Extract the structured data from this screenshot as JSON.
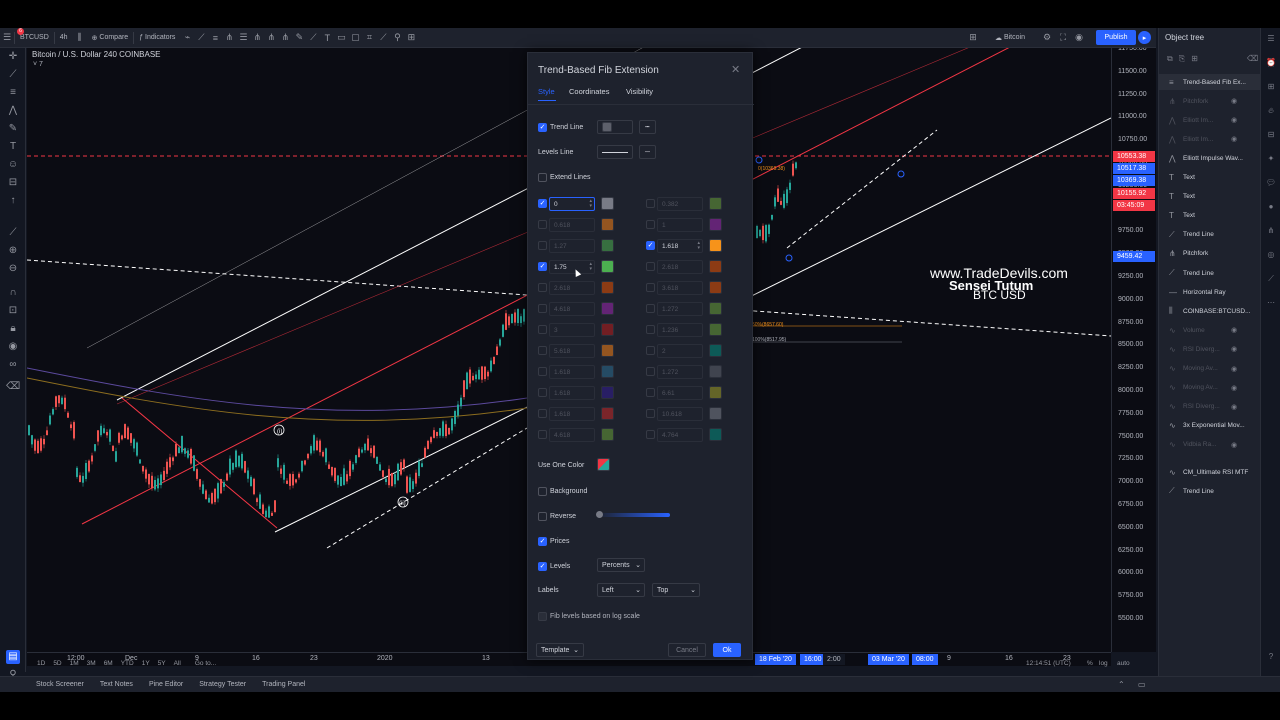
{
  "header": {
    "symbol": "BTCUSD",
    "interval": "4h",
    "compare_label": "Compare",
    "indicators_label": "Indicators",
    "layout_name": "Bitcoin",
    "publish_label": "Publish",
    "notification_count": "6"
  },
  "chart": {
    "title": "Bitcoin / U.S. Dollar  240  COINBASE",
    "collapse": "˅ 7",
    "watermark": {
      "line1": "www.TradeDevils.com",
      "line2": "Sensei Tutum",
      "line3": "BTC USD"
    },
    "price_ticks": [
      "11750.00",
      "11500.00",
      "11250.00",
      "11000.00",
      "10750.00",
      "10500.00",
      "10250.00",
      "10000.00",
      "9750.00",
      "9500.00",
      "9250.00",
      "9000.00",
      "8750.00",
      "8500.00",
      "8250.00",
      "8000.00",
      "7750.00",
      "7500.00",
      "7250.00",
      "7000.00",
      "6750.00",
      "6500.00",
      "6250.00",
      "6000.00",
      "5750.00",
      "5500.00"
    ],
    "price_labels": [
      {
        "text": "10553.38",
        "color": "#f23645"
      },
      {
        "text": "10517.38",
        "color": "#2962ff"
      },
      {
        "text": "10369.38",
        "color": "#2962ff"
      },
      {
        "text": "10155.92",
        "color": "#f23645"
      },
      {
        "text": "03:45:09",
        "color": "#f23645"
      },
      {
        "text": "9459.42",
        "color": "#2962ff"
      }
    ],
    "time_ticks": [
      "12:00",
      "Dec",
      "9",
      "16",
      "23",
      "2020",
      "13",
      "9",
      "16",
      "23"
    ],
    "time_tags": [
      "18 Feb '20",
      "16:00",
      "2:00",
      "03 Mar '20",
      "08:00"
    ],
    "fib_labels": [
      "50%(8657.60)",
      "100%(8517.95)"
    ],
    "wave_labels": [
      "(i)",
      "(ii)"
    ],
    "pitch_label": "0(10369.38)"
  },
  "range_bar": {
    "ranges": [
      "1D",
      "5D",
      "1M",
      "3M",
      "6M",
      "YTD",
      "1Y",
      "5Y",
      "All"
    ],
    "goto": "Go to...",
    "clock": "12:14:51 (UTC)",
    "pct": "%",
    "log": "log",
    "auto": "auto"
  },
  "bottom_tabs": [
    "Stock Screener",
    "Text Notes",
    "Pine Editor",
    "Strategy Tester",
    "Trading Panel"
  ],
  "object_tree": {
    "title": "Object tree",
    "items": [
      {
        "label": "Trend-Based Fib Ex...",
        "icon": "fib-icon",
        "dim": false,
        "selected": true
      },
      {
        "label": "Pitchfork",
        "icon": "pitchfork-icon",
        "dim": true
      },
      {
        "label": "Elliott Im...",
        "icon": "elliott-icon",
        "dim": true
      },
      {
        "label": "Elliott Im...",
        "icon": "elliott-icon",
        "dim": true
      },
      {
        "label": "Elliott Impulse Wav...",
        "icon": "elliott-icon",
        "dim": false
      },
      {
        "label": "Text",
        "icon": "text-icon",
        "dim": false
      },
      {
        "label": "Text",
        "icon": "text-icon",
        "dim": false
      },
      {
        "label": "Text",
        "icon": "text-icon",
        "dim": false
      },
      {
        "label": "Trend Line",
        "icon": "trendline-icon",
        "dim": false
      },
      {
        "label": "Pitchfork",
        "icon": "pitchfork-icon",
        "dim": false
      },
      {
        "label": "Trend Line",
        "icon": "trendline-icon",
        "dim": false
      },
      {
        "label": "Horizontal Ray",
        "icon": "ray-icon",
        "dim": false
      },
      {
        "label": "COINBASE:BTCUSD...",
        "icon": "symbol-icon",
        "dim": false
      },
      {
        "label": "Volume",
        "icon": "indicator-icon",
        "dim": true
      },
      {
        "label": "RSI Diverg...",
        "icon": "indicator-icon",
        "dim": true
      },
      {
        "label": "Moving Av...",
        "icon": "indicator-icon",
        "dim": true
      },
      {
        "label": "Moving Av...",
        "icon": "indicator-icon",
        "dim": true
      },
      {
        "label": "RSI Diverg...",
        "icon": "indicator-icon",
        "dim": true
      },
      {
        "label": "3x Exponential Mov...",
        "icon": "indicator-icon",
        "dim": false
      },
      {
        "label": "Vidbia Ra...",
        "icon": "indicator-icon",
        "dim": true
      },
      {
        "label": "CM_Ultimate RSI MTF",
        "icon": "indicator-icon",
        "dim": false
      },
      {
        "label": "Trend Line",
        "icon": "trendline-icon",
        "dim": false
      }
    ]
  },
  "dialog": {
    "title": "Trend-Based Fib Extension",
    "tabs": [
      "Style",
      "Coordinates",
      "Visibility"
    ],
    "trend_line_label": "Trend Line",
    "levels_line_label": "Levels Line",
    "extend_lines_label": "Extend Lines",
    "levels_left": [
      {
        "value": "0",
        "checked": true,
        "color": "#787b86"
      },
      {
        "value": "0.618",
        "checked": false,
        "color": "#f57f17"
      },
      {
        "value": "1.27",
        "checked": false,
        "color": "#4caf50"
      },
      {
        "value": "1.75",
        "checked": true,
        "color": "#4caf50"
      },
      {
        "value": "2.618",
        "checked": false,
        "color": "#e65100"
      },
      {
        "value": "4.618",
        "checked": false,
        "color": "#9c27b0"
      },
      {
        "value": "3",
        "checked": false,
        "color": "#b71c1c"
      },
      {
        "value": "5.618",
        "checked": false,
        "color": "#f57f17"
      },
      {
        "value": "1.618",
        "checked": false,
        "color": "#2c6e91"
      },
      {
        "value": "1.618",
        "checked": false,
        "color": "#311b92"
      },
      {
        "value": "1.618",
        "checked": false,
        "color": "#c62828"
      },
      {
        "value": "4.618",
        "checked": false,
        "color": "#689f38"
      }
    ],
    "levels_right": [
      {
        "value": "0.382",
        "checked": false,
        "color": "#689f38"
      },
      {
        "value": "1",
        "checked": false,
        "color": "#9c27b0"
      },
      {
        "value": "1.618",
        "checked": true,
        "color": "#f7931a"
      },
      {
        "value": "2.618",
        "checked": false,
        "color": "#e65100"
      },
      {
        "value": "3.618",
        "checked": false,
        "color": "#e65100"
      },
      {
        "value": "1.272",
        "checked": false,
        "color": "#689f38"
      },
      {
        "value": "1.236",
        "checked": false,
        "color": "#689f38"
      },
      {
        "value": "2",
        "checked": false,
        "color": "#00897b"
      },
      {
        "value": "1.272",
        "checked": false,
        "color": "#5d606b"
      },
      {
        "value": "6.61",
        "checked": false,
        "color": "#9e9d24"
      },
      {
        "value": "10.618",
        "checked": false,
        "color": "#787b86"
      },
      {
        "value": "4.764",
        "checked": false,
        "color": "#00897b"
      }
    ],
    "use_one_color_label": "Use One Color",
    "background_label": "Background",
    "reverse_label": "Reverse",
    "prices_label": "Prices",
    "levels_label": "Levels",
    "levels_value": "Percents",
    "labels_label": "Labels",
    "labels_h_value": "Left",
    "labels_v_value": "Top",
    "fib_log_label": "Fib levels based on log scale",
    "template_label": "Template",
    "cancel_label": "Cancel",
    "ok_label": "Ok"
  }
}
